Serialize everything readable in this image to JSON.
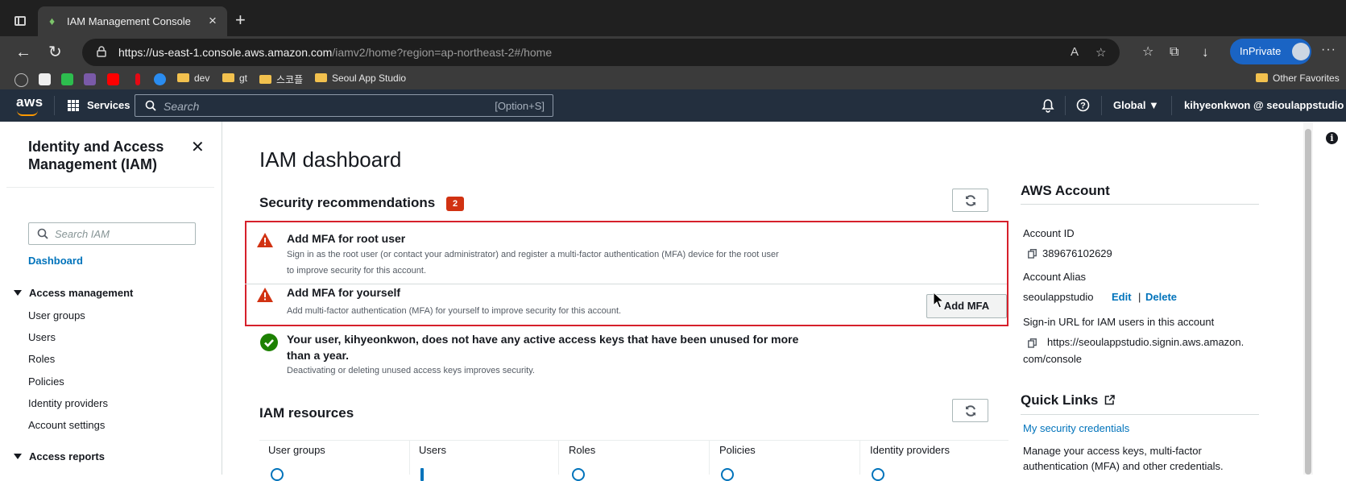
{
  "browser": {
    "tab_title": "IAM Management Console",
    "tab_close": "×",
    "new_tab": "+",
    "url_host": "https://us-east-1.console.aws.amazon.com",
    "url_path": "/iamv2/home?region=ap-northeast-2#/home",
    "inprivate_label": "InPrivate",
    "more_label": "···",
    "bookmarks": [
      "dev",
      "gt",
      "스코플",
      "Seoul App Studio"
    ],
    "other_favorites": "Other Favorites"
  },
  "aws_nav": {
    "logo": "aws",
    "services_label": "Services",
    "search_placeholder": "Search",
    "search_shortcut": "[Option+S]",
    "region_label": "Global ▼",
    "user_label": "kihyeonkwon @ seoulappstudio ▼"
  },
  "sidebar": {
    "title": "Identity and Access Management (IAM)",
    "close": "✕",
    "search_placeholder": "Search IAM",
    "dashboard": "Dashboard",
    "access_management": "Access management",
    "items": [
      "User groups",
      "Users",
      "Roles",
      "Policies",
      "Identity providers",
      "Account settings"
    ],
    "access_reports": "Access reports"
  },
  "main": {
    "page_title": "IAM dashboard",
    "security_title": "Security recommendations",
    "security_count": "2",
    "recs": [
      {
        "title": "Add MFA for root user",
        "desc_line1": "Sign in as the root user (or contact your administrator) and register a multi-factor authentication (MFA) device for the root user",
        "desc_line2": "to improve security for this account."
      },
      {
        "title": "Add MFA for yourself",
        "desc_line1": "Add multi-factor authentication (MFA) for yourself to improve security for this account.",
        "button": "Add MFA"
      }
    ],
    "ok": {
      "title": "Your user, kihyeonkwon, does not have any active access keys that have been unused for more than a year.",
      "desc": "Deactivating or deleting unused access keys improves security."
    },
    "resources_title": "IAM resources",
    "resource_columns": [
      "User groups",
      "Users",
      "Roles",
      "Policies",
      "Identity providers"
    ]
  },
  "account": {
    "title": "AWS Account",
    "id_label": "Account ID",
    "id_value": "389676102629",
    "alias_label": "Account Alias",
    "alias_value": "seoulappstudio",
    "edit": "Edit",
    "separator": "|",
    "delete": "Delete",
    "signin_label": "Sign-in URL for IAM users in this account",
    "signin_line1": "https://seoulappstudio.signin.aws.amazon.",
    "signin_line2": "com/console"
  },
  "quick_links": {
    "title": "Quick Links",
    "link": "My security credentials",
    "desc": "Manage your access keys, multi-factor authentication (MFA) and other credentials."
  },
  "colors": {
    "aws_nav": "#232f3e",
    "link": "#0073bb",
    "badge_red": "#d13212",
    "highlight_red": "#d6202b",
    "success_green": "#1d8102",
    "warning_red": "#d13212"
  }
}
